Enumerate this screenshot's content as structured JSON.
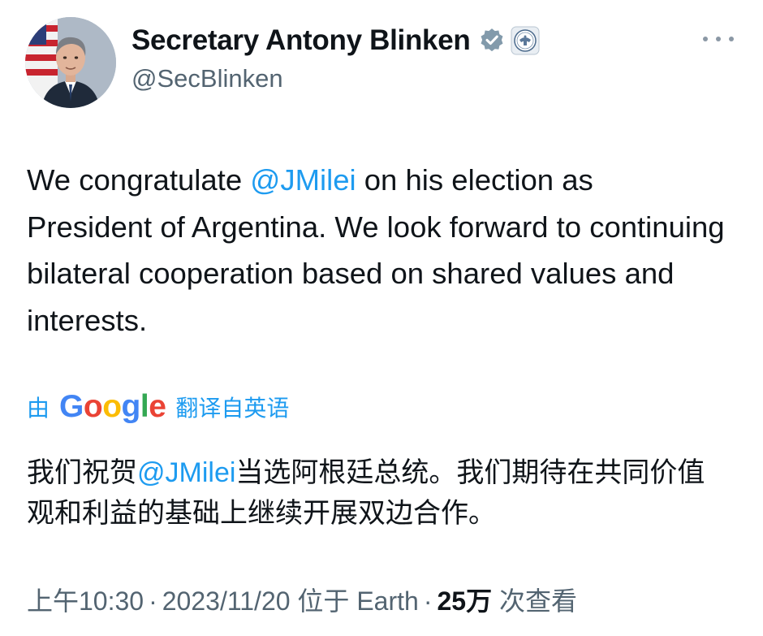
{
  "author": {
    "name": "Secretary Antony Blinken",
    "handle": "@SecBlinken",
    "avatar_icon": "profile-photo",
    "verified_icon": "verified-badge-icon",
    "affiliation_icon": "department-of-state-seal-icon"
  },
  "more_menu_icon": "more-horizontal-icon",
  "tweet": {
    "part1": "We congratulate ",
    "mention": "@JMilei",
    "part2": " on his election as President of Argentina. We look forward to continuing bilateral cooperation based on shared values and interests."
  },
  "translation": {
    "by": "由",
    "google": [
      "G",
      "o",
      "o",
      "g",
      "l",
      "e"
    ],
    "from": "翻译自英语",
    "part1": "我们祝贺",
    "mention": "@JMilei",
    "part2": "当选阿根廷总统。我们期待在共同价值观和利益的基础上继续开展双边合作。"
  },
  "meta": {
    "time": "上午10:30",
    "dot1": "·",
    "date": "2023/11/20",
    "location": "位于 Earth",
    "dot2": "·",
    "views_count": "25万",
    "views_label": "次查看"
  },
  "colors": {
    "mention": "#1d9bf0",
    "secondary_text": "#536471",
    "primary_text": "#0f1419"
  }
}
